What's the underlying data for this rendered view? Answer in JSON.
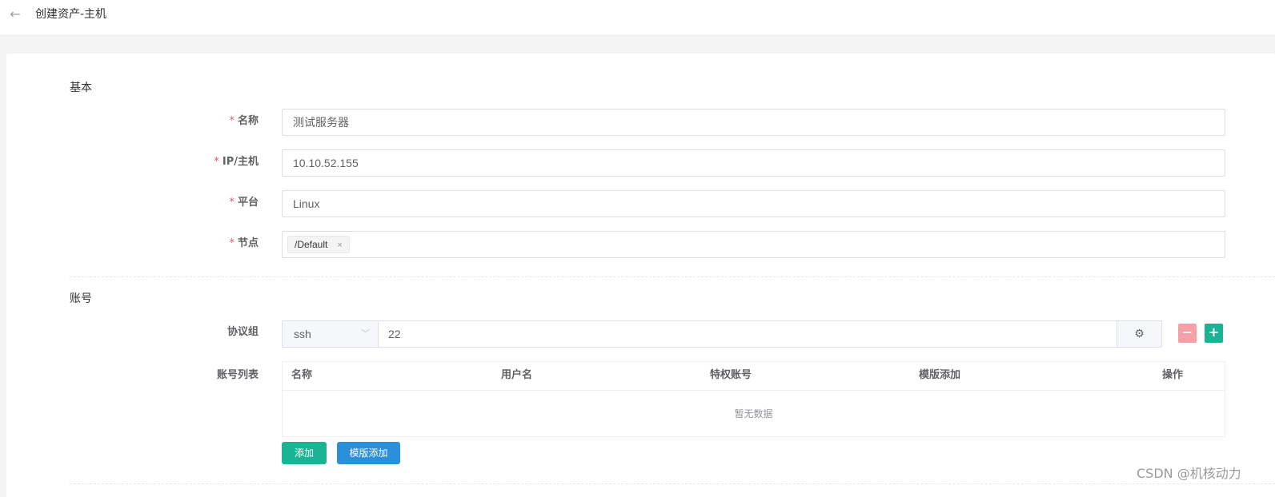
{
  "header": {
    "title": "创建资产-主机"
  },
  "sections": {
    "basic": "基本",
    "account": "账号"
  },
  "basic": {
    "name": {
      "label": "名称",
      "value": "测试服务器"
    },
    "ip": {
      "label": "IP/主机",
      "value": "10.10.52.155"
    },
    "platform": {
      "label": "平台",
      "value": "Linux"
    },
    "nodes": {
      "label": "节点",
      "tags": [
        "/Default"
      ]
    }
  },
  "account": {
    "protocol_label": "协议组",
    "protocol": {
      "name": "ssh",
      "port": "22"
    },
    "accounts_label": "账号列表",
    "table": {
      "columns": [
        "名称",
        "用户名",
        "特权账号",
        "模版添加",
        "操作"
      ],
      "rows": [],
      "empty_text": "暂无数据"
    },
    "add_button": "添加",
    "template_add_button": "模版添加"
  },
  "watermark": "CSDN @机核动力",
  "icons": {
    "back": "arrow-left-icon",
    "close": "close-icon",
    "chevron": "chevron-down-icon",
    "settings": "gear-icon",
    "minus": "minus-icon",
    "plus": "plus-icon"
  },
  "colors": {
    "required": "#ed5565",
    "primary": "#1ab394",
    "info": "#2b8fd9",
    "danger_light": "#f5a0a6"
  }
}
